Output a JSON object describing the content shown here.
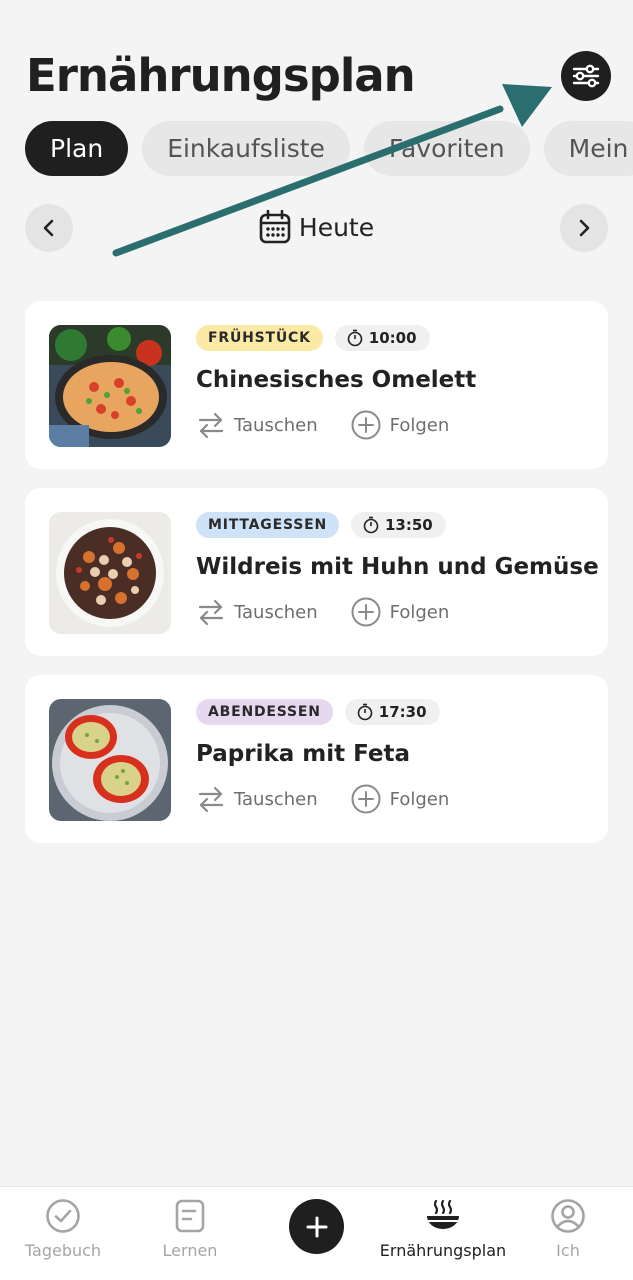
{
  "header": {
    "title": "Ernährungsplan",
    "filter_icon": "sliders-icon"
  },
  "tabs": [
    {
      "label": "Plan",
      "active": true
    },
    {
      "label": "Einkaufsliste",
      "active": false
    },
    {
      "label": "Favoriten",
      "active": false
    },
    {
      "label": "Mein",
      "active": false
    }
  ],
  "date_nav": {
    "label": "Heute",
    "prev_icon": "chevron-left-icon",
    "next_icon": "chevron-right-icon",
    "calendar_icon": "calendar-icon"
  },
  "meals": [
    {
      "category": "FRÜHSTÜCK",
      "category_color": "#fbe9a6",
      "time": "10:00",
      "title": "Chinesisches Omelett",
      "swap_label": "Tauschen",
      "follow_label": "Folgen"
    },
    {
      "category": "MITTAGESSEN",
      "category_color": "#cfe3f8",
      "time": "13:50",
      "title": "Wildreis mit Huhn und Gemüse",
      "swap_label": "Tauschen",
      "follow_label": "Folgen"
    },
    {
      "category": "ABENDESSEN",
      "category_color": "#e6d8ef",
      "time": "17:30",
      "title": "Paprika mit Feta",
      "swap_label": "Tauschen",
      "follow_label": "Folgen"
    }
  ],
  "bottom_nav": {
    "items": [
      {
        "label": "Tagebuch",
        "icon": "check-circle-icon",
        "active": false
      },
      {
        "label": "Lernen",
        "icon": "document-icon",
        "active": false
      },
      {
        "label": "Ernährungsplan",
        "icon": "bowl-icon",
        "active": true
      },
      {
        "label": "Ich",
        "icon": "user-circle-icon",
        "active": false
      }
    ],
    "add_icon": "plus-icon"
  },
  "annotation": {
    "arrow_color": "#2a6e70"
  }
}
